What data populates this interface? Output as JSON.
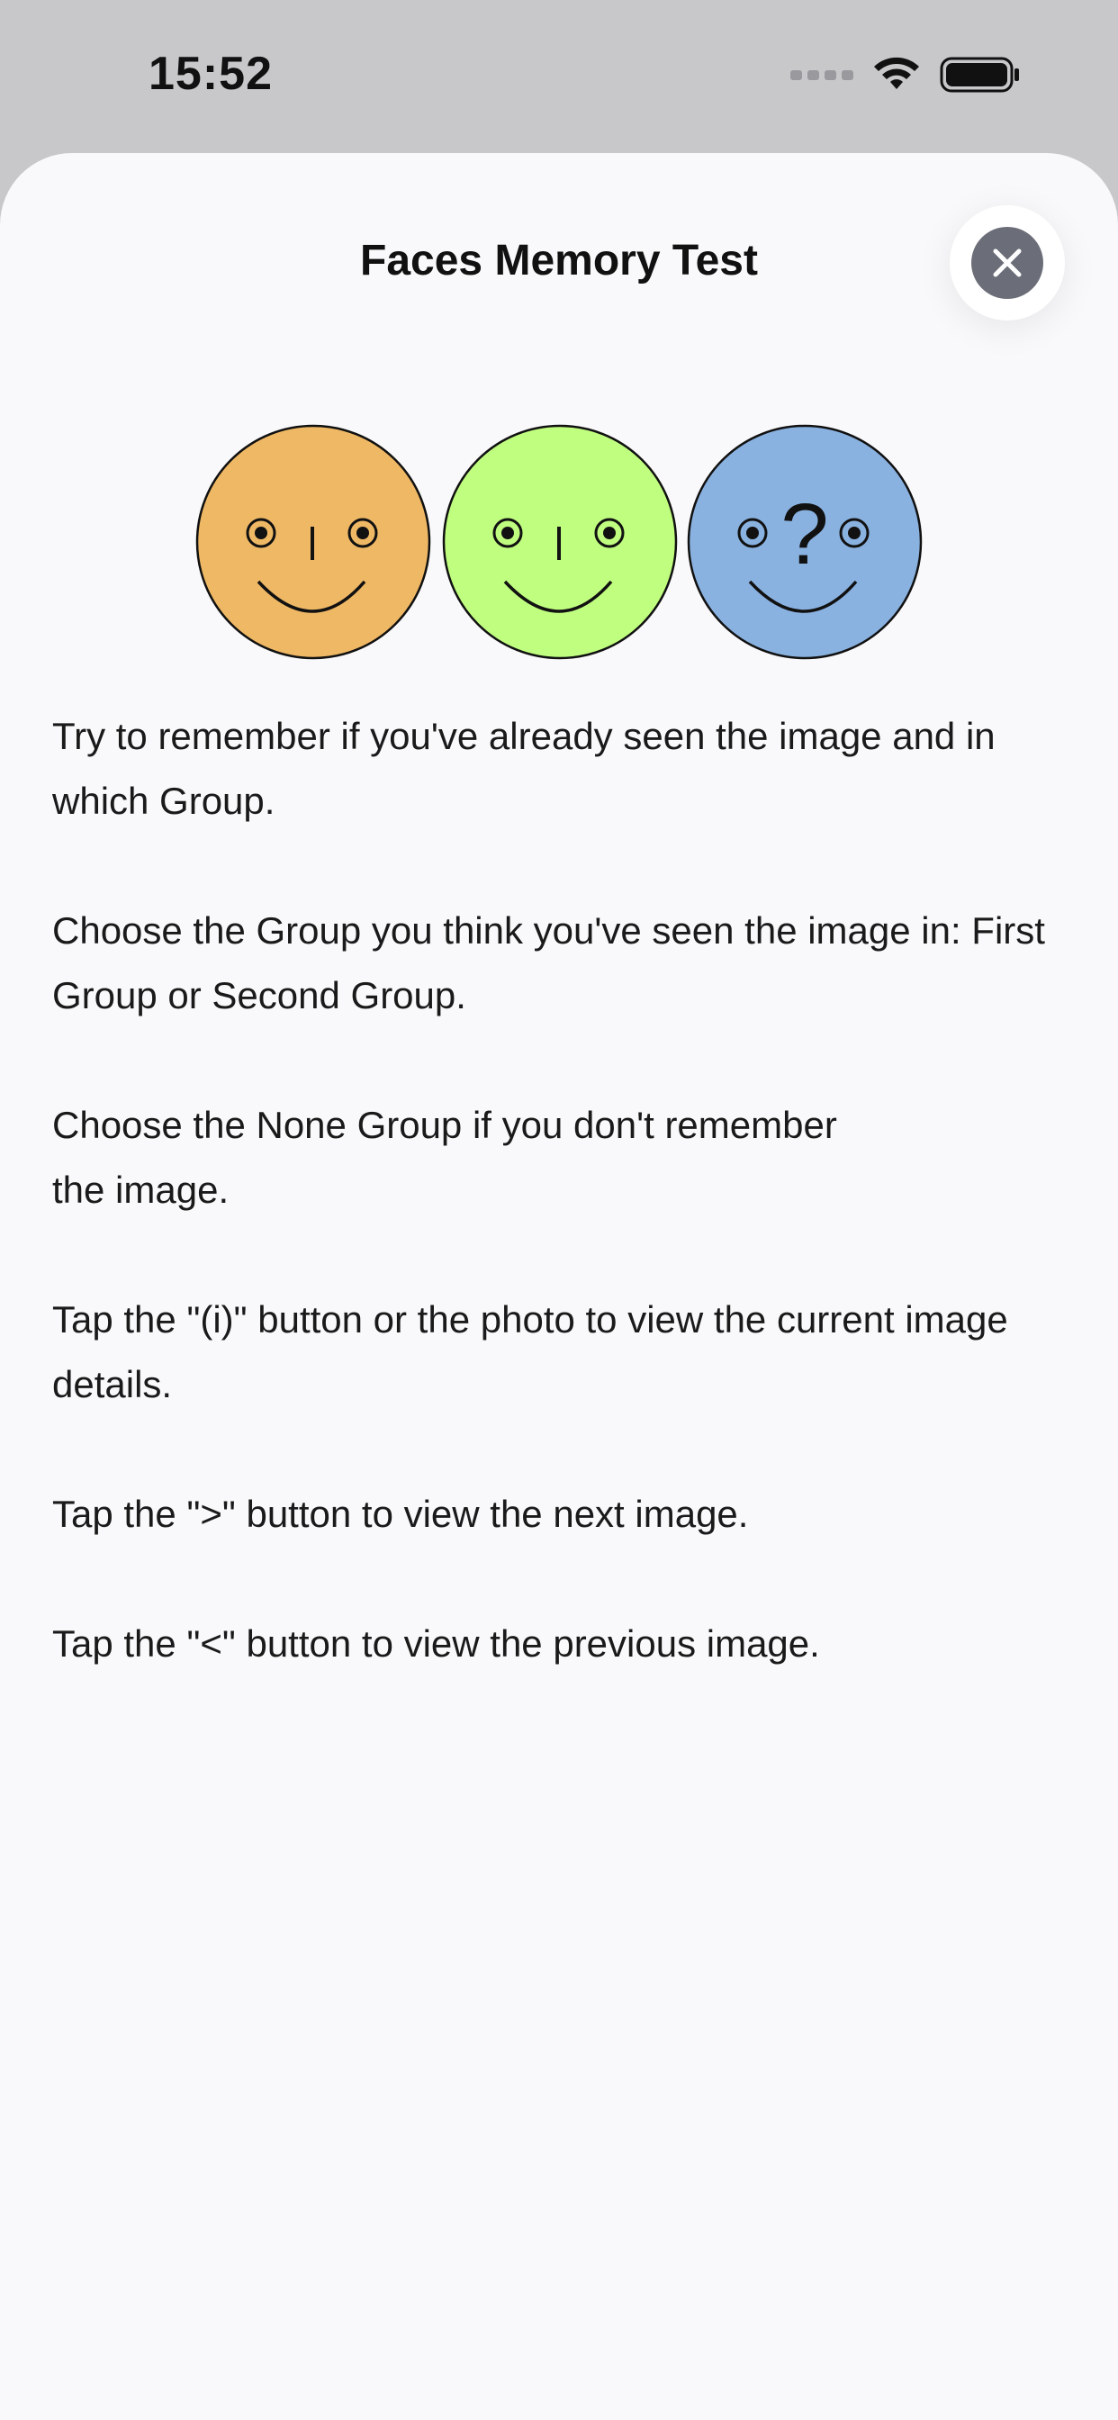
{
  "status_bar": {
    "time": "15:52",
    "icons": [
      "cellular-signal-icon",
      "wifi-icon",
      "battery-icon"
    ]
  },
  "sheet": {
    "title": "Faces Memory Test",
    "close_icon": "close-icon"
  },
  "faces": [
    {
      "name": "first-group-face",
      "color": "#efb865",
      "feature": "nose"
    },
    {
      "name": "second-group-face",
      "color": "#c0fe80",
      "feature": "nose"
    },
    {
      "name": "none-group-face",
      "color": "#8ab2e1",
      "feature": "question-mark"
    }
  ],
  "instructions": [
    "Try to remember if you've already seen the image and in which Group.",
    "Choose the Group you think you've seen the image in: First Group or Second Group.",
    "Choose the None Group if you don't remember\nthe image.",
    "Tap the \"(i)\" button or the photo to view the current image details.",
    "Tap the \">\" button to view the next image.",
    "Tap the \"<\" button to view the previous image."
  ]
}
